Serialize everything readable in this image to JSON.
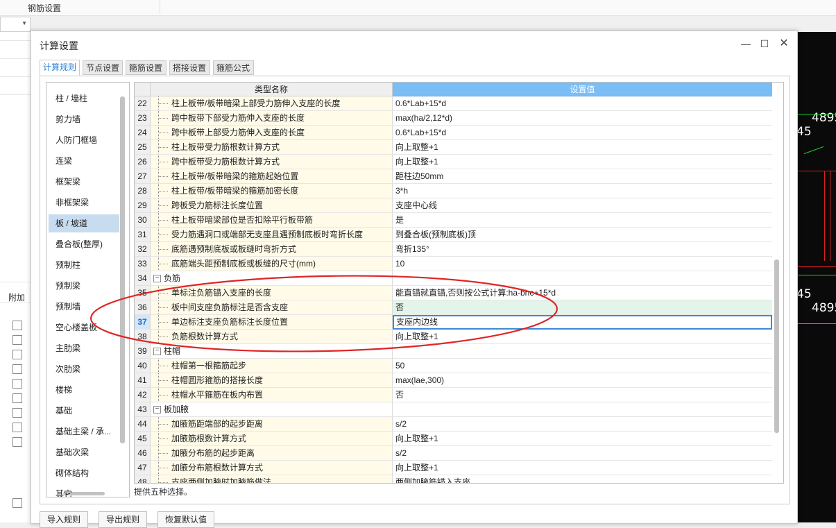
{
  "app": {
    "toolbar_title": "钢筋设置",
    "left_header": "附加",
    "cad_texts": [
      "4895",
      "45",
      "45",
      "4895"
    ]
  },
  "dialog": {
    "title": "计算设置",
    "tabs": [
      "计算规则",
      "节点设置",
      "箍筋设置",
      "搭接设置",
      "箍筋公式"
    ],
    "active_tab": "计算规则",
    "categories": [
      "柱 / 墙柱",
      "剪力墙",
      "人防门框墙",
      "连梁",
      "框架梁",
      "非框架梁",
      "板 / 坡道",
      "叠合板(整厚)",
      "预制柱",
      "预制梁",
      "预制墙",
      "空心楼盖板",
      "主肋梁",
      "次肋梁",
      "楼梯",
      "基础",
      "基础主梁 / 承...",
      "基础次梁",
      "砌体结构",
      "其它"
    ],
    "selected_category": "板 / 坡道",
    "grid": {
      "col_name": "类型名称",
      "col_value": "设置值",
      "rows": [
        {
          "num": "22",
          "name": "柱上板带/板带暗梁上部受力筋伸入支座的长度",
          "value": "0.6*Lab+15*d"
        },
        {
          "num": "23",
          "name": "跨中板带下部受力筋伸入支座的长度",
          "value": "max(ha/2,12*d)"
        },
        {
          "num": "24",
          "name": "跨中板带上部受力筋伸入支座的长度",
          "value": "0.6*Lab+15*d"
        },
        {
          "num": "25",
          "name": "柱上板带受力筋根数计算方式",
          "value": "向上取整+1"
        },
        {
          "num": "26",
          "name": "跨中板带受力筋根数计算方式",
          "value": "向上取整+1"
        },
        {
          "num": "27",
          "name": "柱上板带/板带暗梁的箍筋起始位置",
          "value": "距柱边50mm"
        },
        {
          "num": "28",
          "name": "柱上板带/板带暗梁的箍筋加密长度",
          "value": "3*h"
        },
        {
          "num": "29",
          "name": "跨板受力筋标注长度位置",
          "value": "支座中心线"
        },
        {
          "num": "30",
          "name": "柱上板带暗梁部位是否扣除平行板带筋",
          "value": "是"
        },
        {
          "num": "31",
          "name": "受力筋遇洞口或端部无支座且遇预制底板时弯折长度",
          "value": "到叠合板(预制底板)顶"
        },
        {
          "num": "32",
          "name": "底筋遇预制底板或板缝时弯折方式",
          "value": "弯折135°"
        },
        {
          "num": "33",
          "name": "底筋端头距预制底板或板缝的尺寸(mm)",
          "value": "10"
        },
        {
          "num": "34",
          "name": "负筋",
          "value": "",
          "category": true
        },
        {
          "num": "35",
          "name": "单标注负筋锚入支座的长度",
          "value": "能直锚就直锚,否则按公式计算:ha-bhc+15*d"
        },
        {
          "num": "36",
          "name": "板中间支座负筋标注是否含支座",
          "value": "否"
        },
        {
          "num": "37",
          "name": "单边标注支座负筋标注长度位置",
          "value": "支座内边线"
        },
        {
          "num": "38",
          "name": "负筋根数计算方式",
          "value": "向上取整+1"
        },
        {
          "num": "39",
          "name": "柱帽",
          "value": "",
          "category": true
        },
        {
          "num": "40",
          "name": "柱帽第一根箍筋起步",
          "value": "50"
        },
        {
          "num": "41",
          "name": "柱帽圆形箍筋的搭接长度",
          "value": "max(lae,300)"
        },
        {
          "num": "42",
          "name": "柱帽水平箍筋在板内布置",
          "value": "否"
        },
        {
          "num": "43",
          "name": "板加腋",
          "value": "",
          "category": true
        },
        {
          "num": "44",
          "name": "加腋筋距端部的起步距离",
          "value": "s/2"
        },
        {
          "num": "45",
          "name": "加腋筋根数计算方式",
          "value": "向上取整+1"
        },
        {
          "num": "46",
          "name": "加腋分布筋的起步距离",
          "value": "s/2"
        },
        {
          "num": "47",
          "name": "加腋分布筋根数计算方式",
          "value": "向上取整+1"
        },
        {
          "num": "48",
          "name": "支座两侧加腋时加腋筋做法",
          "value": "两侧加腋筋锚入支座"
        }
      ],
      "highlighted_row": "36",
      "current_row": "37"
    },
    "hint": "提供五种选择。",
    "buttons": {
      "import": "导入规则",
      "export": "导出规则",
      "restore": "恢复默认值"
    }
  },
  "colors": {
    "accent": "#2a7fd4",
    "header_value_bg": "#7bbdf5",
    "name_cell_bg": "#fffbe8",
    "annotation": "#e02424"
  }
}
